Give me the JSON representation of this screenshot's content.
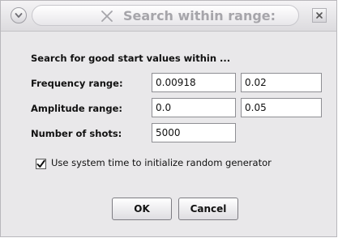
{
  "dialog": {
    "title": "Search within range:",
    "window_menu_icon": "chevron-down-icon",
    "title_icon": "x-icon",
    "close_icon": "close-icon"
  },
  "form": {
    "heading": "Search for good start values within ...",
    "frequency": {
      "label": "Frequency range:",
      "min": "0.00918",
      "max": "0.02"
    },
    "amplitude": {
      "label": "Amplitude range:",
      "min": "0.0",
      "max": "0.05"
    },
    "shots": {
      "label": "Number of shots:",
      "value": "5000"
    },
    "use_system_time": {
      "label": "Use system time to initialize random generator",
      "checked": true,
      "check_glyph": "✔"
    }
  },
  "buttons": {
    "ok": "OK",
    "cancel": "Cancel"
  },
  "colors": {
    "window_bg": "#e9e8ea",
    "title_text": "#a6a5aa",
    "field_border": "#8f8f94"
  }
}
